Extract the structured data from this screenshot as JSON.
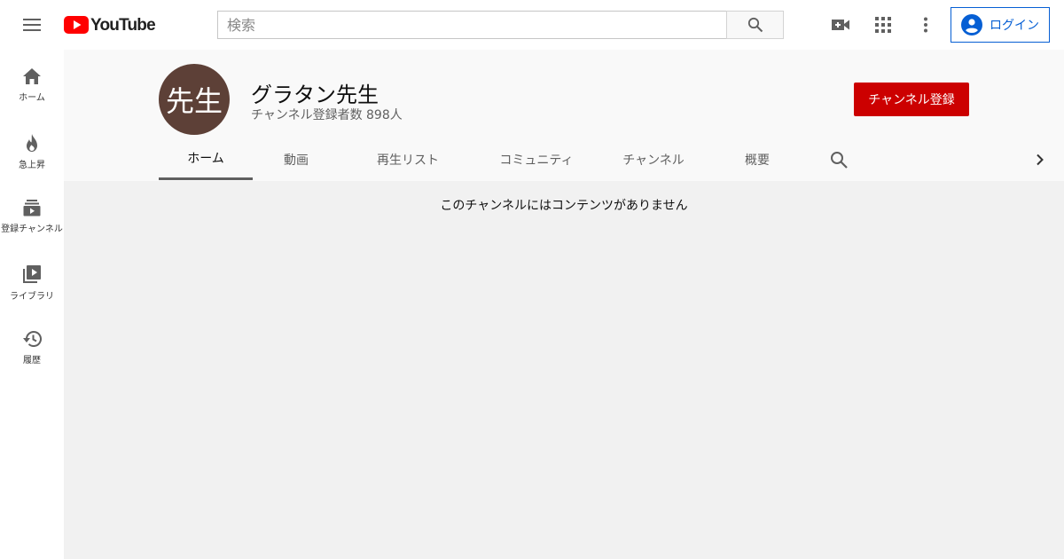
{
  "header": {
    "logo_text": "YouTube",
    "search_placeholder": "検索",
    "login_label": "ログイン",
    "icons": [
      "menu-icon",
      "youtube-logo-icon",
      "search-icon",
      "video-create-icon",
      "apps-grid-icon",
      "more-vert-icon",
      "account-circle-icon"
    ],
    "brand_color": "#ff0000",
    "link_color": "#065fd4"
  },
  "sidebar": {
    "items": [
      {
        "label": "ホーム",
        "icon": "home-icon"
      },
      {
        "label": "急上昇",
        "icon": "trending-icon"
      },
      {
        "label": "登録チャンネル",
        "icon": "subscriptions-icon"
      },
      {
        "label": "ライブラリ",
        "icon": "library-icon"
      },
      {
        "label": "履歴",
        "icon": "history-icon"
      }
    ]
  },
  "channel": {
    "avatar_text": "先生",
    "avatar_color": "#5d4037",
    "name": "グラタン先生",
    "subscribers": "チャンネル登録者数 898人",
    "subscribe_label": "チャンネル登録",
    "subscribe_color": "#cc0000",
    "tabs": [
      {
        "label": "ホーム",
        "active": true
      },
      {
        "label": "動画",
        "active": false
      },
      {
        "label": "再生リスト",
        "active": false
      },
      {
        "label": "コミュニティ",
        "active": false
      },
      {
        "label": "チャンネル",
        "active": false
      },
      {
        "label": "概要",
        "active": false
      }
    ]
  },
  "content": {
    "empty_message": "このチャンネルにはコンテンツがありません"
  }
}
